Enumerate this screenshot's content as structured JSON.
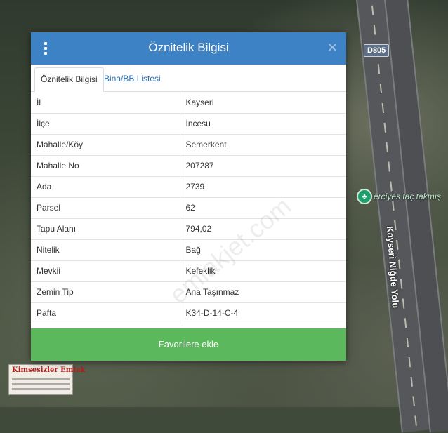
{
  "map": {
    "road_badge": "D805",
    "poi_label": "erciyes taç takmış",
    "road_name": "Kayseri Niğde Yolu",
    "logo_title": "Kimsesizler Emlak"
  },
  "dialog": {
    "title": "Öznitelik Bilgisi",
    "menu_icon": "kebab-menu-icon",
    "close_icon": "close-icon",
    "tabs": [
      {
        "label": "Öznitelik Bilgisi",
        "active": true
      },
      {
        "label": "Bina/BB Listesi",
        "active": false
      }
    ],
    "rows": [
      {
        "key": "İl",
        "value": "Kayseri"
      },
      {
        "key": "İlçe",
        "value": "İncesu"
      },
      {
        "key": "Mahalle/Köy",
        "value": "Semerkent"
      },
      {
        "key": "Mahalle No",
        "value": "207287"
      },
      {
        "key": "Ada",
        "value": "2739"
      },
      {
        "key": "Parsel",
        "value": "62"
      },
      {
        "key": "Tapu Alanı",
        "value": "794,02"
      },
      {
        "key": "Nitelik",
        "value": "Bağ"
      },
      {
        "key": "Mevkii",
        "value": "Kefeklik"
      },
      {
        "key": "Zemin Tip",
        "value": "Ana Taşınmaz"
      },
      {
        "key": "Pafta",
        "value": "K34-D-14-C-4"
      }
    ],
    "favorite_button": "Favorilere ekle",
    "watermark": "emlakjet.com"
  },
  "colors": {
    "header": "#3e82c6",
    "button": "#5cb85c",
    "tab_link": "#2d6fad"
  }
}
